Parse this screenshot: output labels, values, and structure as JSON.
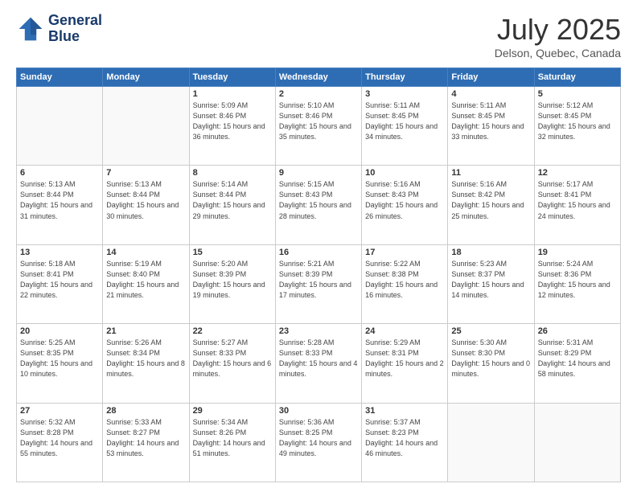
{
  "header": {
    "logo_line1": "General",
    "logo_line2": "Blue",
    "month": "July 2025",
    "location": "Delson, Quebec, Canada"
  },
  "days_of_week": [
    "Sunday",
    "Monday",
    "Tuesday",
    "Wednesday",
    "Thursday",
    "Friday",
    "Saturday"
  ],
  "weeks": [
    [
      {
        "day": "",
        "sunrise": "",
        "sunset": "",
        "daylight": ""
      },
      {
        "day": "",
        "sunrise": "",
        "sunset": "",
        "daylight": ""
      },
      {
        "day": "1",
        "sunrise": "Sunrise: 5:09 AM",
        "sunset": "Sunset: 8:46 PM",
        "daylight": "Daylight: 15 hours and 36 minutes."
      },
      {
        "day": "2",
        "sunrise": "Sunrise: 5:10 AM",
        "sunset": "Sunset: 8:46 PM",
        "daylight": "Daylight: 15 hours and 35 minutes."
      },
      {
        "day": "3",
        "sunrise": "Sunrise: 5:11 AM",
        "sunset": "Sunset: 8:45 PM",
        "daylight": "Daylight: 15 hours and 34 minutes."
      },
      {
        "day": "4",
        "sunrise": "Sunrise: 5:11 AM",
        "sunset": "Sunset: 8:45 PM",
        "daylight": "Daylight: 15 hours and 33 minutes."
      },
      {
        "day": "5",
        "sunrise": "Sunrise: 5:12 AM",
        "sunset": "Sunset: 8:45 PM",
        "daylight": "Daylight: 15 hours and 32 minutes."
      }
    ],
    [
      {
        "day": "6",
        "sunrise": "Sunrise: 5:13 AM",
        "sunset": "Sunset: 8:44 PM",
        "daylight": "Daylight: 15 hours and 31 minutes."
      },
      {
        "day": "7",
        "sunrise": "Sunrise: 5:13 AM",
        "sunset": "Sunset: 8:44 PM",
        "daylight": "Daylight: 15 hours and 30 minutes."
      },
      {
        "day": "8",
        "sunrise": "Sunrise: 5:14 AM",
        "sunset": "Sunset: 8:44 PM",
        "daylight": "Daylight: 15 hours and 29 minutes."
      },
      {
        "day": "9",
        "sunrise": "Sunrise: 5:15 AM",
        "sunset": "Sunset: 8:43 PM",
        "daylight": "Daylight: 15 hours and 28 minutes."
      },
      {
        "day": "10",
        "sunrise": "Sunrise: 5:16 AM",
        "sunset": "Sunset: 8:43 PM",
        "daylight": "Daylight: 15 hours and 26 minutes."
      },
      {
        "day": "11",
        "sunrise": "Sunrise: 5:16 AM",
        "sunset": "Sunset: 8:42 PM",
        "daylight": "Daylight: 15 hours and 25 minutes."
      },
      {
        "day": "12",
        "sunrise": "Sunrise: 5:17 AM",
        "sunset": "Sunset: 8:41 PM",
        "daylight": "Daylight: 15 hours and 24 minutes."
      }
    ],
    [
      {
        "day": "13",
        "sunrise": "Sunrise: 5:18 AM",
        "sunset": "Sunset: 8:41 PM",
        "daylight": "Daylight: 15 hours and 22 minutes."
      },
      {
        "day": "14",
        "sunrise": "Sunrise: 5:19 AM",
        "sunset": "Sunset: 8:40 PM",
        "daylight": "Daylight: 15 hours and 21 minutes."
      },
      {
        "day": "15",
        "sunrise": "Sunrise: 5:20 AM",
        "sunset": "Sunset: 8:39 PM",
        "daylight": "Daylight: 15 hours and 19 minutes."
      },
      {
        "day": "16",
        "sunrise": "Sunrise: 5:21 AM",
        "sunset": "Sunset: 8:39 PM",
        "daylight": "Daylight: 15 hours and 17 minutes."
      },
      {
        "day": "17",
        "sunrise": "Sunrise: 5:22 AM",
        "sunset": "Sunset: 8:38 PM",
        "daylight": "Daylight: 15 hours and 16 minutes."
      },
      {
        "day": "18",
        "sunrise": "Sunrise: 5:23 AM",
        "sunset": "Sunset: 8:37 PM",
        "daylight": "Daylight: 15 hours and 14 minutes."
      },
      {
        "day": "19",
        "sunrise": "Sunrise: 5:24 AM",
        "sunset": "Sunset: 8:36 PM",
        "daylight": "Daylight: 15 hours and 12 minutes."
      }
    ],
    [
      {
        "day": "20",
        "sunrise": "Sunrise: 5:25 AM",
        "sunset": "Sunset: 8:35 PM",
        "daylight": "Daylight: 15 hours and 10 minutes."
      },
      {
        "day": "21",
        "sunrise": "Sunrise: 5:26 AM",
        "sunset": "Sunset: 8:34 PM",
        "daylight": "Daylight: 15 hours and 8 minutes."
      },
      {
        "day": "22",
        "sunrise": "Sunrise: 5:27 AM",
        "sunset": "Sunset: 8:33 PM",
        "daylight": "Daylight: 15 hours and 6 minutes."
      },
      {
        "day": "23",
        "sunrise": "Sunrise: 5:28 AM",
        "sunset": "Sunset: 8:33 PM",
        "daylight": "Daylight: 15 hours and 4 minutes."
      },
      {
        "day": "24",
        "sunrise": "Sunrise: 5:29 AM",
        "sunset": "Sunset: 8:31 PM",
        "daylight": "Daylight: 15 hours and 2 minutes."
      },
      {
        "day": "25",
        "sunrise": "Sunrise: 5:30 AM",
        "sunset": "Sunset: 8:30 PM",
        "daylight": "Daylight: 15 hours and 0 minutes."
      },
      {
        "day": "26",
        "sunrise": "Sunrise: 5:31 AM",
        "sunset": "Sunset: 8:29 PM",
        "daylight": "Daylight: 14 hours and 58 minutes."
      }
    ],
    [
      {
        "day": "27",
        "sunrise": "Sunrise: 5:32 AM",
        "sunset": "Sunset: 8:28 PM",
        "daylight": "Daylight: 14 hours and 55 minutes."
      },
      {
        "day": "28",
        "sunrise": "Sunrise: 5:33 AM",
        "sunset": "Sunset: 8:27 PM",
        "daylight": "Daylight: 14 hours and 53 minutes."
      },
      {
        "day": "29",
        "sunrise": "Sunrise: 5:34 AM",
        "sunset": "Sunset: 8:26 PM",
        "daylight": "Daylight: 14 hours and 51 minutes."
      },
      {
        "day": "30",
        "sunrise": "Sunrise: 5:36 AM",
        "sunset": "Sunset: 8:25 PM",
        "daylight": "Daylight: 14 hours and 49 minutes."
      },
      {
        "day": "31",
        "sunrise": "Sunrise: 5:37 AM",
        "sunset": "Sunset: 8:23 PM",
        "daylight": "Daylight: 14 hours and 46 minutes."
      },
      {
        "day": "",
        "sunrise": "",
        "sunset": "",
        "daylight": ""
      },
      {
        "day": "",
        "sunrise": "",
        "sunset": "",
        "daylight": ""
      }
    ]
  ]
}
